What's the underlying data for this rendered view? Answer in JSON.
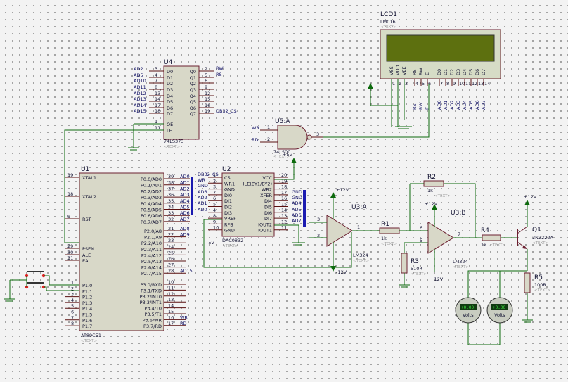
{
  "u4": {
    "ref": "U4",
    "part": "74LS373",
    "text": "<TEXT>",
    "left_nets": [
      "AD2",
      "AD5",
      "AD10",
      "AD11",
      "AD12",
      "AD13",
      "AD14",
      "AD15"
    ],
    "left_nums": [
      "3",
      "4",
      "7",
      "8",
      "13",
      "14",
      "17",
      "18"
    ],
    "left_pins": [
      "D0",
      "D1",
      "D2",
      "D3",
      "D4",
      "D5",
      "D6",
      "D7"
    ],
    "right_pins": [
      "Q0",
      "Q1",
      "Q2",
      "Q3",
      "Q4",
      "Q5",
      "Q6",
      "Q7"
    ],
    "right_nums": [
      "2",
      "5",
      "6",
      "9",
      "12",
      "15",
      "16",
      "19"
    ],
    "ctrl_pins": [
      "OE",
      "LE"
    ],
    "ctrl_nums": [
      "1",
      "11"
    ],
    "out_nets": [
      "RW",
      "RS",
      "DB32_CS"
    ]
  },
  "u5": {
    "ref": "U5:A",
    "part": "74LS00",
    "text": "<TEXT>",
    "in_nets": [
      "WR",
      "RD"
    ],
    "in_nums": [
      "1",
      "2"
    ],
    "out_num": "3"
  },
  "lcd": {
    "ref": "LCD1",
    "part": "LM016L",
    "text": "<TEXT>",
    "pins": [
      "VSS",
      "VDD",
      "VEE",
      "RS",
      "RW",
      "E",
      "D0",
      "D1",
      "D2",
      "D3",
      "D4",
      "D5",
      "D6",
      "D7"
    ],
    "nums": [
      "1",
      "2",
      "3",
      "4",
      "5",
      "6",
      "7",
      "8",
      "9",
      "10",
      "11",
      "12",
      "13",
      "14"
    ],
    "nets": [
      "RS",
      "RW",
      "E",
      "AD0",
      "AD1",
      "AD2",
      "AD3",
      "AD4",
      "AD5",
      "AD6",
      "AD7"
    ]
  },
  "u1": {
    "ref": "U1",
    "part": "AT89C51",
    "text": "<TEXT>",
    "left_pins": [
      "XTAL1",
      "XTAL2",
      "RST",
      "PSEN",
      "ALE",
      "EA"
    ],
    "left_nums": [
      "19",
      "18",
      "9",
      "29",
      "30",
      "31"
    ],
    "p1_pins": [
      "P1.0",
      "P1.1",
      "P1.2",
      "P1.3",
      "P1.4",
      "P1.5",
      "P1.6",
      "P1.7"
    ],
    "p1_nums": [
      "1",
      "2",
      "3",
      "4",
      "5",
      "6",
      "7",
      "8"
    ],
    "p0_pins": [
      "P0.0/AD0",
      "P0.1/AD1",
      "P0.2/AD2",
      "P0.3/AD3",
      "P0.4/AD4",
      "P0.5/AD5",
      "P0.6/AD6",
      "P0.7/AD7"
    ],
    "p0_nums": [
      "39",
      "38",
      "37",
      "36",
      "35",
      "34",
      "33",
      "32"
    ],
    "p0_nets": [
      "AD0",
      "AD1",
      "AD2",
      "AD3",
      "AD4",
      "AD5",
      "AD6",
      "AD7"
    ],
    "p2_pins": [
      "P2.0/A8",
      "P2.1/A9",
      "P2.2/A10",
      "P2.3/A11",
      "P2.4/A12",
      "P2.5/A13",
      "P2.6/A14",
      "P2.7/A15"
    ],
    "p2_nums": [
      "21",
      "22",
      "23",
      "24",
      "25",
      "26",
      "27",
      "28"
    ],
    "p2_nets": [
      "AD8",
      "AD9",
      "",
      "",
      "",
      "",
      "",
      "AD15"
    ],
    "p3_pins": [
      "P3.0/RXD",
      "P3.1/TXD",
      "P3.2/INT0",
      "P3.3/INT1",
      "P3.4/T0",
      "P3.5/T1",
      "P3.6/WR",
      "P3.7/RD"
    ],
    "p3_nums": [
      "10",
      "11",
      "12",
      "13",
      "14",
      "15",
      "16",
      "17"
    ],
    "p3_nets": [
      "",
      "",
      "",
      "",
      "",
      "",
      "WR",
      "RD"
    ]
  },
  "u2": {
    "ref": "U2",
    "part": "DAC0832",
    "text": "<TEXT>",
    "left_pins": [
      "CS",
      "WR1",
      "GND",
      "DI0",
      "DI1",
      "DI2",
      "DI3",
      "VREF",
      "RFB",
      "GND"
    ],
    "left_nums": [
      "1",
      "2",
      "3",
      "7",
      "6",
      "5",
      "4",
      "8",
      "9",
      "10"
    ],
    "left_nets": [
      "DB32_CS",
      "WR",
      "GND",
      "AD3",
      "AD2",
      "AD1",
      "AD0"
    ],
    "right_pins": [
      "VCC",
      "ILE(BY1/BY2)",
      "WR2",
      "XFER",
      "DI4",
      "DI5",
      "DI6",
      "DI7",
      "IOUT2",
      "IOUT1"
    ],
    "right_nums": [
      "20",
      "19",
      "18",
      "17",
      "16",
      "15",
      "14",
      "13",
      "12",
      "11"
    ],
    "right_nets": [
      "GND",
      "GND",
      "AD4",
      "AD5",
      "AD6",
      "AD7"
    ],
    "vcc": "+5V",
    "vref": "-5V"
  },
  "u3a": {
    "ref": "U3:A",
    "part": "LM324",
    "text": "<TEXT>",
    "pins": [
      "3",
      "2",
      "1",
      "4",
      "11"
    ],
    "vp": "+12V",
    "vn": "-12V"
  },
  "u3b": {
    "ref": "U3:B",
    "part": "LM324",
    "text": "<TEXT>",
    "pins": [
      "6",
      "5",
      "7",
      "4",
      "11"
    ],
    "vp": "+12V",
    "vn": "+12V"
  },
  "r1": {
    "ref": "R1",
    "value": "1k",
    "text": "<TEXT>"
  },
  "r2": {
    "ref": "R2",
    "value": "1k",
    "text": "<TEXT>"
  },
  "r3": {
    "ref": "R3",
    "value": "510R",
    "text": "<TEXT>"
  },
  "r4": {
    "ref": "R4",
    "value": "1k",
    "text": "<TEXT>"
  },
  "r5": {
    "ref": "R5",
    "value": "100R",
    "text": "<TEXT>"
  },
  "q1": {
    "ref": "Q1",
    "part": "2N2222A",
    "text": "<TEXT>"
  },
  "supply": {
    "v12": "+12V",
    "gnd": "GND"
  },
  "meter": {
    "label": "Volts",
    "display": "+0.00"
  }
}
